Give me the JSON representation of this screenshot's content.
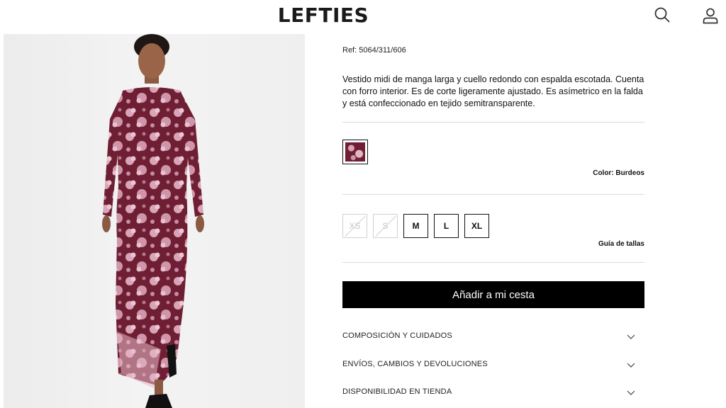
{
  "header": {
    "logo": "LEFTIES",
    "search_icon": "search-icon",
    "user_icon": "user-icon"
  },
  "product": {
    "ref": "Ref: 5064/311/606",
    "description": "Vestido midi de manga larga y cuello redondo con espalda escotada. Cuenta con forro interior. Es de corte ligeramente ajustado. Es asímetrico en la falda y está confeccionado en tejido semitransparente.",
    "color_label": "Color: Burdeos",
    "swatch_color": "#6e1f33",
    "sizes": [
      {
        "label": "XS",
        "available": false
      },
      {
        "label": "S",
        "available": false
      },
      {
        "label": "M",
        "available": true
      },
      {
        "label": "L",
        "available": true
      },
      {
        "label": "XL",
        "available": true
      }
    ],
    "size_guide": "Guía de tallas",
    "add_to_cart": "Añadir a mi cesta"
  },
  "accordion": [
    {
      "label": "COMPOSICIÓN Y CUIDADOS",
      "icon": "chevron-down-icon"
    },
    {
      "label": "ENVÍOS, CAMBIOS Y DEVOLUCIONES",
      "icon": "chevron-down-icon"
    },
    {
      "label": "DISPONIBILIDAD EN TIENDA",
      "icon": "chevron-down-icon"
    }
  ],
  "colors": {
    "dress": "#6e1f33",
    "print": "#d9a3b8",
    "button": "#000000"
  }
}
